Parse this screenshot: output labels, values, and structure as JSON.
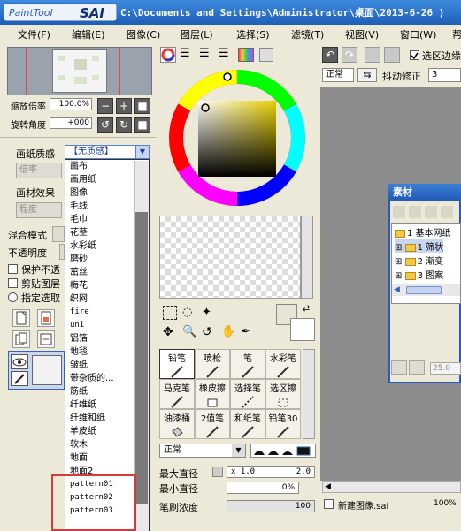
{
  "title_bar": {
    "app_logo_text": "PaintTool SAI",
    "path_text": "C:\\Documents and Settings\\Administrator\\桌面\\2013-6-26 )"
  },
  "menu": [
    "文件(F)",
    "编辑(E)",
    "图像(C)",
    "图层(L)",
    "选择(S)",
    "滤镜(T)",
    "视图(V)",
    "窗口(W)",
    "帮"
  ],
  "navigator": {
    "zoom_label": "缩放倍率",
    "zoom_value": "100.0%",
    "rotate_label": "旋转角度",
    "rotate_value": "+000"
  },
  "layer_props": {
    "paper_quality_label": "画纸质感",
    "paper_quality_value": "【无质感】",
    "scale_placeholder": "倍率",
    "material_effect_label": "画材效果",
    "degree_placeholder": "程度",
    "blend_mode_label": "混合模式",
    "opacity_label": "不透明度",
    "protect_opacity_label": "保护不透",
    "clip_layer_label": "剪贴图层",
    "selection_source_label": "指定选取"
  },
  "dropdown_items": [
    "画布",
    "画用纸",
    "图像",
    "毛线",
    "毛巾",
    "花茎",
    "水彩纸",
    "磨砂",
    "茁丝",
    "梅花",
    "织网",
    "fire",
    "uni",
    "铝箔",
    "地毯",
    "皱纸",
    "带杂质的...",
    "筋纸",
    "纤维纸",
    "纤维和纸",
    "羊皮纸",
    "软木",
    "地面",
    "地面2",
    "pattern01",
    "pattern02",
    "pattern03"
  ],
  "tools": {
    "row1": [
      "铅笔",
      "喷枪",
      "笔",
      "水彩笔"
    ],
    "row2": [
      "马克笔",
      "橡皮擦",
      "选择笔",
      "选区擦"
    ],
    "row3": [
      "油漆桶",
      "2值笔",
      "和纸笔",
      "铅笔30"
    ]
  },
  "brush": {
    "blend_value": "正常",
    "max_size_label": "最大直径",
    "max_size_multiplier": "x 1.0",
    "max_size_value": "2.0",
    "min_size_label": "最小直径",
    "min_size_value": "0%",
    "density_label": "笔刷浓度",
    "density_value": "100"
  },
  "right_toolbar": {
    "blend_value": "正常",
    "stabilizer_label": "抖动修正",
    "stabilizer_value": "3",
    "selection_edge_label": "选区边缘"
  },
  "material_window": {
    "title": "素材",
    "root": "1 基本网纸",
    "children": [
      "1 筛状",
      "2 渐变",
      "3 图案"
    ],
    "field_value": "25.0"
  },
  "status": {
    "file_name": "新建图像.sai",
    "zoom": "100%"
  },
  "colors": {
    "titlebar": "#2f78d0",
    "panel": "#ece9d8",
    "canvas_bg": "#8c8c8c",
    "highlight": "#d13c3c"
  }
}
